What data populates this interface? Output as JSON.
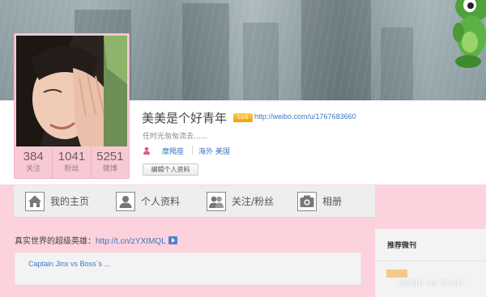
{
  "profile": {
    "name": "美美是个好青年",
    "level_badge": "Lv.6",
    "profile_url": "http://weibo.com/u/1767683660",
    "signature": "任时光匆匆流去......",
    "tags": [
      "摩羯座",
      "海外 美国"
    ],
    "edit_button": "编辑个人资料",
    "stats": [
      {
        "value": "384",
        "label": "关注"
      },
      {
        "value": "1041",
        "label": "粉丝"
      },
      {
        "value": "5251",
        "label": "微博"
      }
    ]
  },
  "nav": {
    "items": [
      {
        "label": "我的主页",
        "icon": "home-icon"
      },
      {
        "label": "个人资料",
        "icon": "person-icon"
      },
      {
        "label": "关注/粉丝",
        "icon": "people-icon"
      },
      {
        "label": "相册",
        "icon": "camera-icon"
      }
    ]
  },
  "feed": {
    "intro_text": "真实世界的超级英雄：",
    "intro_link": "http://t.cn/zYXIMQL",
    "card_link": "Captain Jinx vs Boss`s ..."
  },
  "sidebar": {
    "title": "推荐微刊"
  },
  "watermark": "made on fiverr",
  "colors": {
    "pink_background": "#fcd2dc",
    "link_blue": "#3a78c8",
    "badge_gold": "#e8a400"
  }
}
